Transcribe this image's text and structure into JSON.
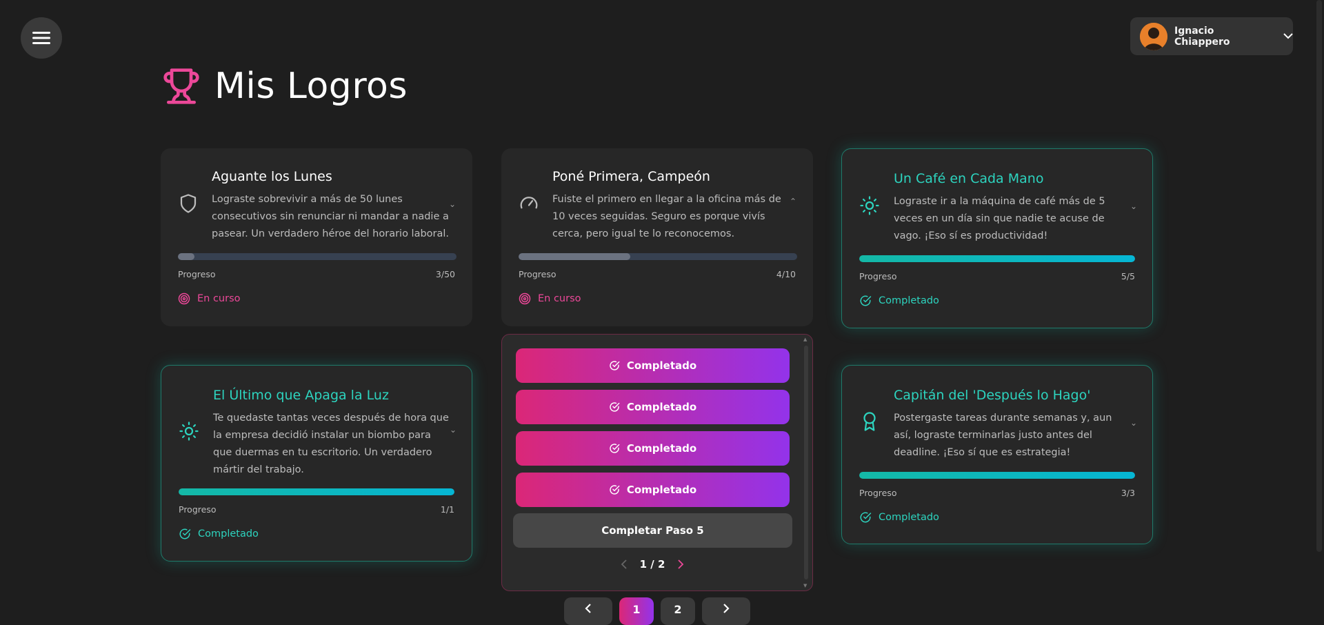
{
  "header": {
    "title": "Mis Logros",
    "user_name": "Ignacio Chiappero"
  },
  "achievements": [
    {
      "title": "Aguante los Lunes",
      "description": "Lograste sobrevivir a más de 50 lunes consecutivos sin renunciar ni mandar a nadie a pasear. Un verdadero héroe del horario laboral.",
      "icon": "shield-icon",
      "progress_label": "Progreso",
      "progress_text": "3/50",
      "progress_fraction": 0.06,
      "status": "En curso"
    },
    {
      "title": "Poné Primera, Campeón",
      "description": "Fuiste el primero en llegar a la oficina más de 10 veces seguidas. Seguro es porque vivís cerca, pero igual te lo reconocemos.",
      "icon": "speedometer-icon",
      "progress_label": "Progreso",
      "progress_text": "4/10",
      "progress_fraction": 0.4,
      "status": "En curso"
    },
    {
      "title": "Un Café en Cada Mano",
      "description": "Lograste ir a la máquina de café más de 5 veces en un día sin que nadie te acuse de vago. ¡Eso sí es productividad!",
      "icon": "sun-icon",
      "progress_label": "Progreso",
      "progress_text": "5/5",
      "progress_fraction": 1,
      "status": "Completado"
    },
    {
      "title": "El Último que Apaga la Luz",
      "description": "Te quedaste tantas veces después de hora que la empresa decidió instalar un biombo para que duermas en tu escritorio. Un verdadero mártir del trabajo.",
      "icon": "sun-icon",
      "progress_label": "Progreso",
      "progress_text": "1/1",
      "progress_fraction": 1,
      "status": "Completado"
    },
    {
      "title": "Capitán del 'Después lo Hago'",
      "description": "Postergaste tareas durante semanas y, aun así, lograste terminarlas justo antes del deadline. ¡Eso sí que es estrategia!",
      "icon": "award-ribbon-icon",
      "progress_label": "Progreso",
      "progress_text": "3/3",
      "progress_fraction": 1,
      "status": "Completado"
    }
  ],
  "steps_panel": {
    "completed_steps": [
      "Completado",
      "Completado",
      "Completado",
      "Completado"
    ],
    "next_step_label": "Completar Paso 5",
    "page_indicator": "1 / 2"
  },
  "pagination": {
    "pages": [
      "1",
      "2"
    ],
    "current": "1"
  },
  "colors": {
    "accent_pink": "#ec4899",
    "accent_teal": "#2dd4bf",
    "gradient_start": "#db2777",
    "gradient_end": "#9333ea"
  }
}
